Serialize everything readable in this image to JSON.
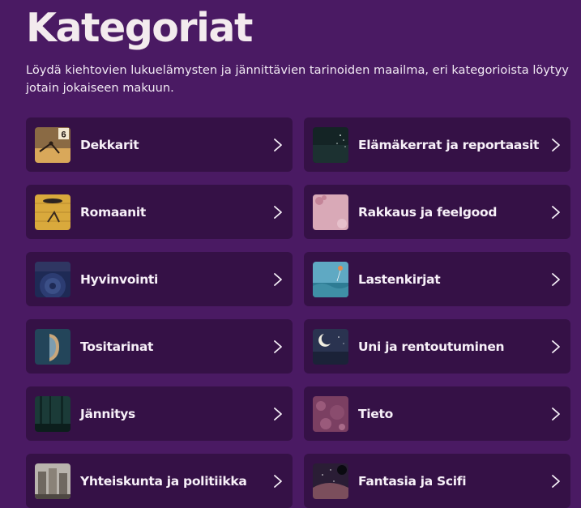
{
  "header": {
    "title": "Kategoriat",
    "description": "Löydä kiehtovien lukuelämysten ja jännittävien tarinoiden maailma, eri kategorioista löytyy jotain jokaiseen makuun."
  },
  "categories": [
    {
      "label": "Dekkarit",
      "thumb_colors": [
        "#3b2b25",
        "#d9a85a"
      ],
      "badge": "6"
    },
    {
      "label": "Elämäkerrat ja reportaasit",
      "thumb_colors": [
        "#142425",
        "#22393a"
      ]
    },
    {
      "label": "Romaanit",
      "thumb_colors": [
        "#d9a93c",
        "#b78a2d"
      ]
    },
    {
      "label": "Rakkaus ja feelgood",
      "thumb_colors": [
        "#d9a9b7",
        "#b7869a"
      ]
    },
    {
      "label": "Hyvinvointi",
      "thumb_colors": [
        "#1e2a55",
        "#3b4f87"
      ]
    },
    {
      "label": "Lastenkirjat",
      "thumb_colors": [
        "#5fa9c3",
        "#2e7c94"
      ]
    },
    {
      "label": "Tositarinat",
      "thumb_colors": [
        "#23455a",
        "#c9a77b"
      ]
    },
    {
      "label": "Uni ja rentoutuminen",
      "thumb_colors": [
        "#2a3350",
        "#1b2238"
      ]
    },
    {
      "label": "Jännitys",
      "thumb_colors": [
        "#1b3b38",
        "#0f2624"
      ]
    },
    {
      "label": "Tieto",
      "thumb_colors": [
        "#7b3f62",
        "#9a5a7b"
      ]
    },
    {
      "label": "Yhteiskunta ja politiikka",
      "thumb_colors": [
        "#b9b4ad",
        "#6f6860"
      ]
    },
    {
      "label": "Fantasia ja Scifi",
      "thumb_colors": [
        "#2a1d35",
        "#7b4e5c"
      ]
    }
  ],
  "icons": {
    "chevron": "chevron-right-icon"
  },
  "colors": {
    "background": "#4a1a63",
    "card": "#351146",
    "text": "#f7f0f8"
  }
}
